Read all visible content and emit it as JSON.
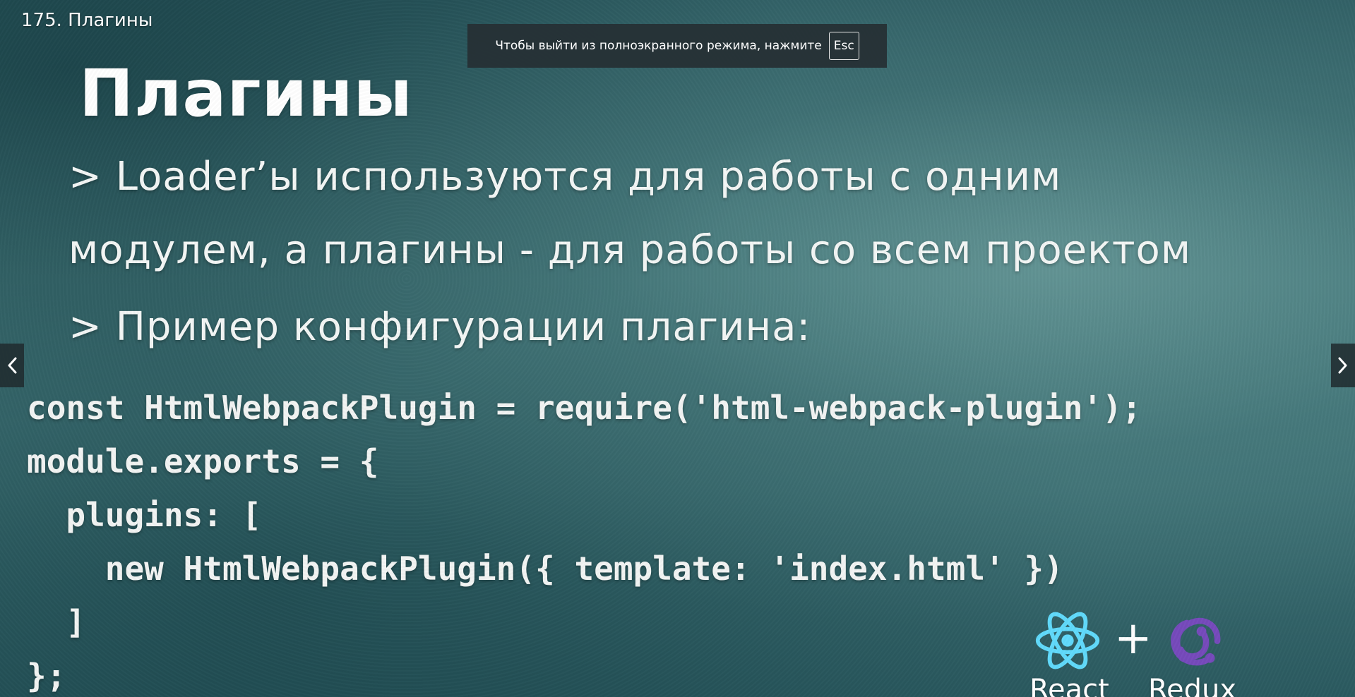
{
  "player": {
    "video_title": "175. Плагины",
    "fullscreen_notice": {
      "text": "Чтобы выйти из полноэкранного режима, нажмите",
      "key": "Esc"
    },
    "nav": {
      "prev_icon": "chevron-left-icon",
      "next_icon": "chevron-right-icon"
    }
  },
  "slide": {
    "heading": "Плагины",
    "bullets": [
      "> Loader’ы используются для работы с одним",
      "модулем, а плагины - для работы со всем проектом",
      "> Пример  конфигурации плагина:"
    ],
    "code_lines": [
      "const HtmlWebpackPlugin = require('html-webpack-plugin');",
      "module.exports = {",
      "  plugins: [",
      "    new HtmlWebpackPlugin({ template: 'index.html' })",
      "  ]",
      "};"
    ],
    "logos": {
      "react": {
        "icon": "react-logo-icon",
        "label": "React",
        "color": "#61dafb"
      },
      "plus": "+",
      "redux": {
        "icon": "redux-logo-icon",
        "label": "Redux",
        "color": "#764abc"
      }
    }
  },
  "colors": {
    "background": "#3f6e72",
    "text": "#ffffff",
    "overlay": "#263035"
  }
}
